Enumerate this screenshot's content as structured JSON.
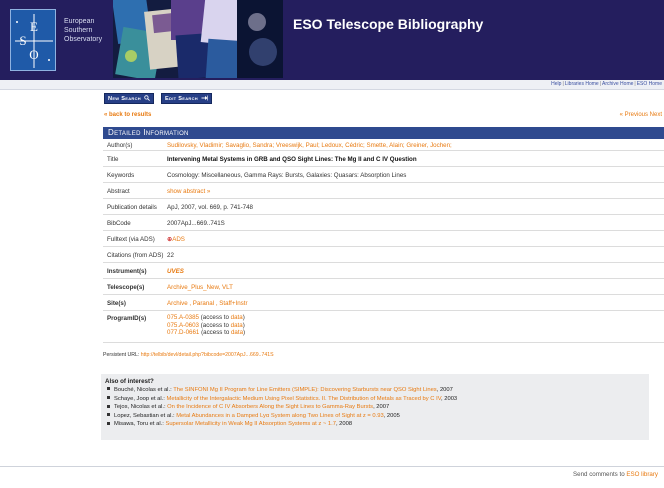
{
  "header": {
    "logo_letters": "ESO",
    "org_line1": "European",
    "org_line2": "Southern",
    "org_line3": "Observatory",
    "title": "ESO Telescope Bibliography"
  },
  "util_links": [
    "Help",
    "Libraries Home",
    "Archive Home",
    "ESO Home"
  ],
  "buttons": {
    "new_search": "New Search",
    "edit_search": "Edit Search"
  },
  "nav": {
    "back": "« back to results",
    "prev_next": "« Previous  Next"
  },
  "panel": {
    "heading": "Detailed Information",
    "rows": {
      "authors_label": "Author(s)",
      "authors_value": "Sudilovsky, Vladimir; Savaglio, Sandra; Vreeswijk, Paul; Ledoux, Cédric; Smette, Alain; Greiner, Jochen;",
      "title_label": "Title",
      "title_value": "Intervening Metal Systems in GRB and QSO Sight Lines: The Mg II and C IV Question",
      "keywords_label": "Keywords",
      "keywords_value": "Cosmology: Miscellaneous, Gamma Rays: Bursts, Galaxies: Quasars: Absorption Lines",
      "abstract_label": "Abstract",
      "abstract_value": "show abstract »",
      "pub_label": "Publication details",
      "pub_value": "ApJ, 2007, vol. 669, p. 741-748",
      "bibcode_label": "BibCode",
      "bibcode_value": "2007ApJ...669..741S",
      "fulltext_label": "Fulltext (via ADS)",
      "fulltext_mark": "⊕",
      "fulltext_value": "ADS",
      "citations_label": "Citations (from ADS)",
      "citations_value": "22",
      "instrument_label": "Instrument(s)",
      "instrument_value": "UVES",
      "telescope_label": "Telescope(s)",
      "telescope_value": "Archive_Plus_New, VLT",
      "site_label": "Site(s)",
      "site_value": "Archive , Paranal , Staff+Instr",
      "program_label": "ProgramID(s)",
      "programs": [
        {
          "id": "075.A-0385",
          "mid": " (access to ",
          "link": "data",
          "end": ")"
        },
        {
          "id": "075.A-0603",
          "mid": " (access to ",
          "link": "data",
          "end": ")"
        },
        {
          "id": "077.D-0661",
          "mid": " (access to ",
          "link": "data",
          "end": ")"
        }
      ]
    }
  },
  "persistent": {
    "label": "Persistent URL: ",
    "url": "http://telbib/devl/detail.php?bibcode=2007ApJ...669..741S"
  },
  "interest": {
    "title": "Also of interest?",
    "items": [
      {
        "author": "Bouché, Nicolas et al.: ",
        "link": "The SINFONI Mg II Program for Line Emitters (SIMPLE): Discovering Starbursts near QSO Sight Lines",
        "year": ", 2007"
      },
      {
        "author": "Schaye, Joop et al.: ",
        "link": "Metallicity of the Intergalactic Medium Using Pixel Statistics. II. The Distribution of Metals as Traced by C IV",
        "year": ", 2003"
      },
      {
        "author": "Tejos, Nicolas et al.: ",
        "link": "On the Incidence of C IV Absorbers Along the Sight Lines to Gamma-Ray Bursts",
        "year": ", 2007"
      },
      {
        "author": "Lopez, Sebastian et al.: ",
        "link": "Metal Abundances in a Damped Lyα System along Two Lines of Sight at z = 0.93",
        "year": ", 2005"
      },
      {
        "author": "Misawa, Toru et al.: ",
        "link": "Supersolar Metallicity in Weak Mg II Absorption Systems at z ~ 1.7",
        "year": ", 2008"
      }
    ]
  },
  "footer": {
    "text": "Send comments to ",
    "link": "ESO library"
  },
  "colors": {
    "header_bg": "#241e5e",
    "accent_blue": "#2f4a8f",
    "link_orange": "#e87a10"
  }
}
